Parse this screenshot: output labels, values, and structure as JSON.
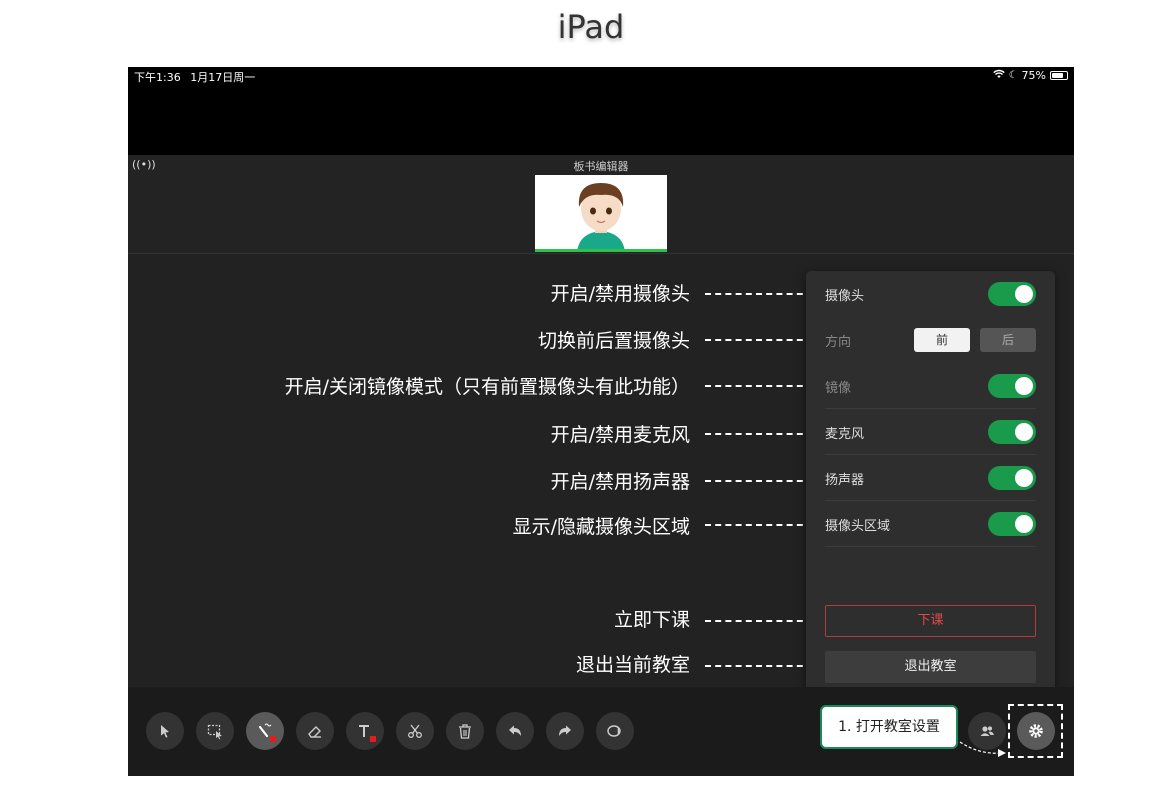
{
  "page_title": "iPad",
  "status_bar": {
    "time": "下午1:36",
    "date": "1月17日周一",
    "battery_pct": "75%",
    "battery_level": 0.75
  },
  "header": {
    "title": "板书编辑器"
  },
  "annotations": [
    "开启/禁用摄像头",
    "切换前后置摄像头",
    "开启/关闭镜像模式（只有前置摄像头有此功能）",
    "开启/禁用麦克风",
    "开启/禁用扬声器",
    "显示/隐藏摄像头区域",
    "立即下课",
    "退出当前教室"
  ],
  "settings": {
    "camera": {
      "label": "摄像头",
      "on": true
    },
    "direction": {
      "label": "方向",
      "front": "前",
      "back": "后",
      "selected": "前"
    },
    "mirror": {
      "label": "镜像",
      "on": true
    },
    "microphone": {
      "label": "麦克风",
      "on": true
    },
    "speaker": {
      "label": "扬声器",
      "on": true
    },
    "camera_area": {
      "label": "摄像头区域",
      "on": true
    },
    "end_class_label": "下课",
    "exit_label": "退出教室"
  },
  "toolbar": {
    "tools": [
      "select-icon",
      "area-select-icon",
      "pen-icon",
      "eraser-icon",
      "text-icon",
      "scissors-icon",
      "trash-icon",
      "undo-icon",
      "redo-icon",
      "lasso-icon"
    ],
    "active_tool": "pen-icon",
    "right": [
      "users-icon",
      "gear-icon"
    ]
  },
  "callout": "1. 打开教室设置",
  "colors": {
    "toggle_on": "#1a9b4c",
    "end_class": "#e24848",
    "callout_border": "#1a8a5c",
    "pen_color": "#e21d1d"
  }
}
